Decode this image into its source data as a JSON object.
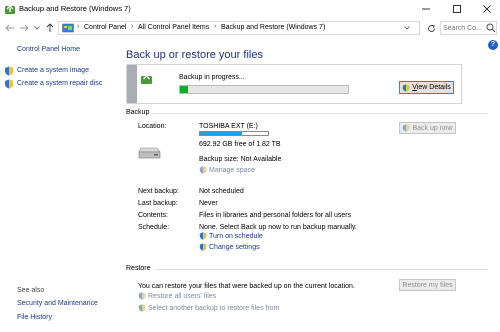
{
  "window": {
    "title": "Backup and Restore (Windows 7)",
    "minimize_glyph": "—",
    "maximize_glyph": "☐",
    "close_glyph": "✕",
    "app_icon": "backup-restore-icon"
  },
  "address_bar": {
    "breadcrumbs": [
      "Control Panel",
      "All Control Panel Items",
      "Backup and Restore (Windows 7)"
    ],
    "separator": "›",
    "search_placeholder": "Search Co..."
  },
  "left_pane": {
    "home_link": "Control Panel Home",
    "tasks": [
      {
        "label": "Create a system image",
        "icon": "shield-icon"
      },
      {
        "label": "Create a system repair disc",
        "icon": "shield-icon"
      }
    ],
    "see_also_label": "See also",
    "see_also": [
      "Security and Maintenance",
      "File History"
    ]
  },
  "help": {
    "glyph": "?"
  },
  "main": {
    "heading": "Back up or restore your files",
    "progress": {
      "text": "Backup in progress...",
      "fraction": 0.05,
      "view_details_label": "View Details",
      "view_details_underline": "V",
      "view_details_rest": "iew Details"
    },
    "backup": {
      "section_label": "Backup",
      "location_label": "Location:",
      "location_value": "TOSHIBA EXT (E:)",
      "drive_used_fraction": 0.62,
      "free_space": "692.92 GB free of 1.82 TB",
      "backup_size": "Backup size: Not Available",
      "manage_space_link": "Manage space",
      "backup_now_label": "Back up now",
      "next_backup_label": "Next backup:",
      "next_backup_value": "Not scheduled",
      "last_backup_label": "Last backup:",
      "last_backup_value": "Never",
      "contents_label": "Contents:",
      "contents_value": "Files in libraries and personal folders for all users",
      "schedule_label": "Schedule:",
      "schedule_value": "None. Select Back up now to run backup manually.",
      "turn_on_schedule_link": "Turn on schedule",
      "change_settings_link": "Change settings"
    },
    "restore": {
      "section_label": "Restore",
      "description": "You can restore your files that were backed up on the current location.",
      "restore_all_link": "Restore all users' files",
      "select_another_link": "Select another backup to restore files from",
      "restore_files_label": "Restore my files"
    }
  },
  "colors": {
    "link": "#1a3a8a",
    "heading": "#1e3287",
    "progress_fill": "#06b025",
    "drive_bar": "#26a0da",
    "panel_stripe": "#a9aeb4"
  }
}
